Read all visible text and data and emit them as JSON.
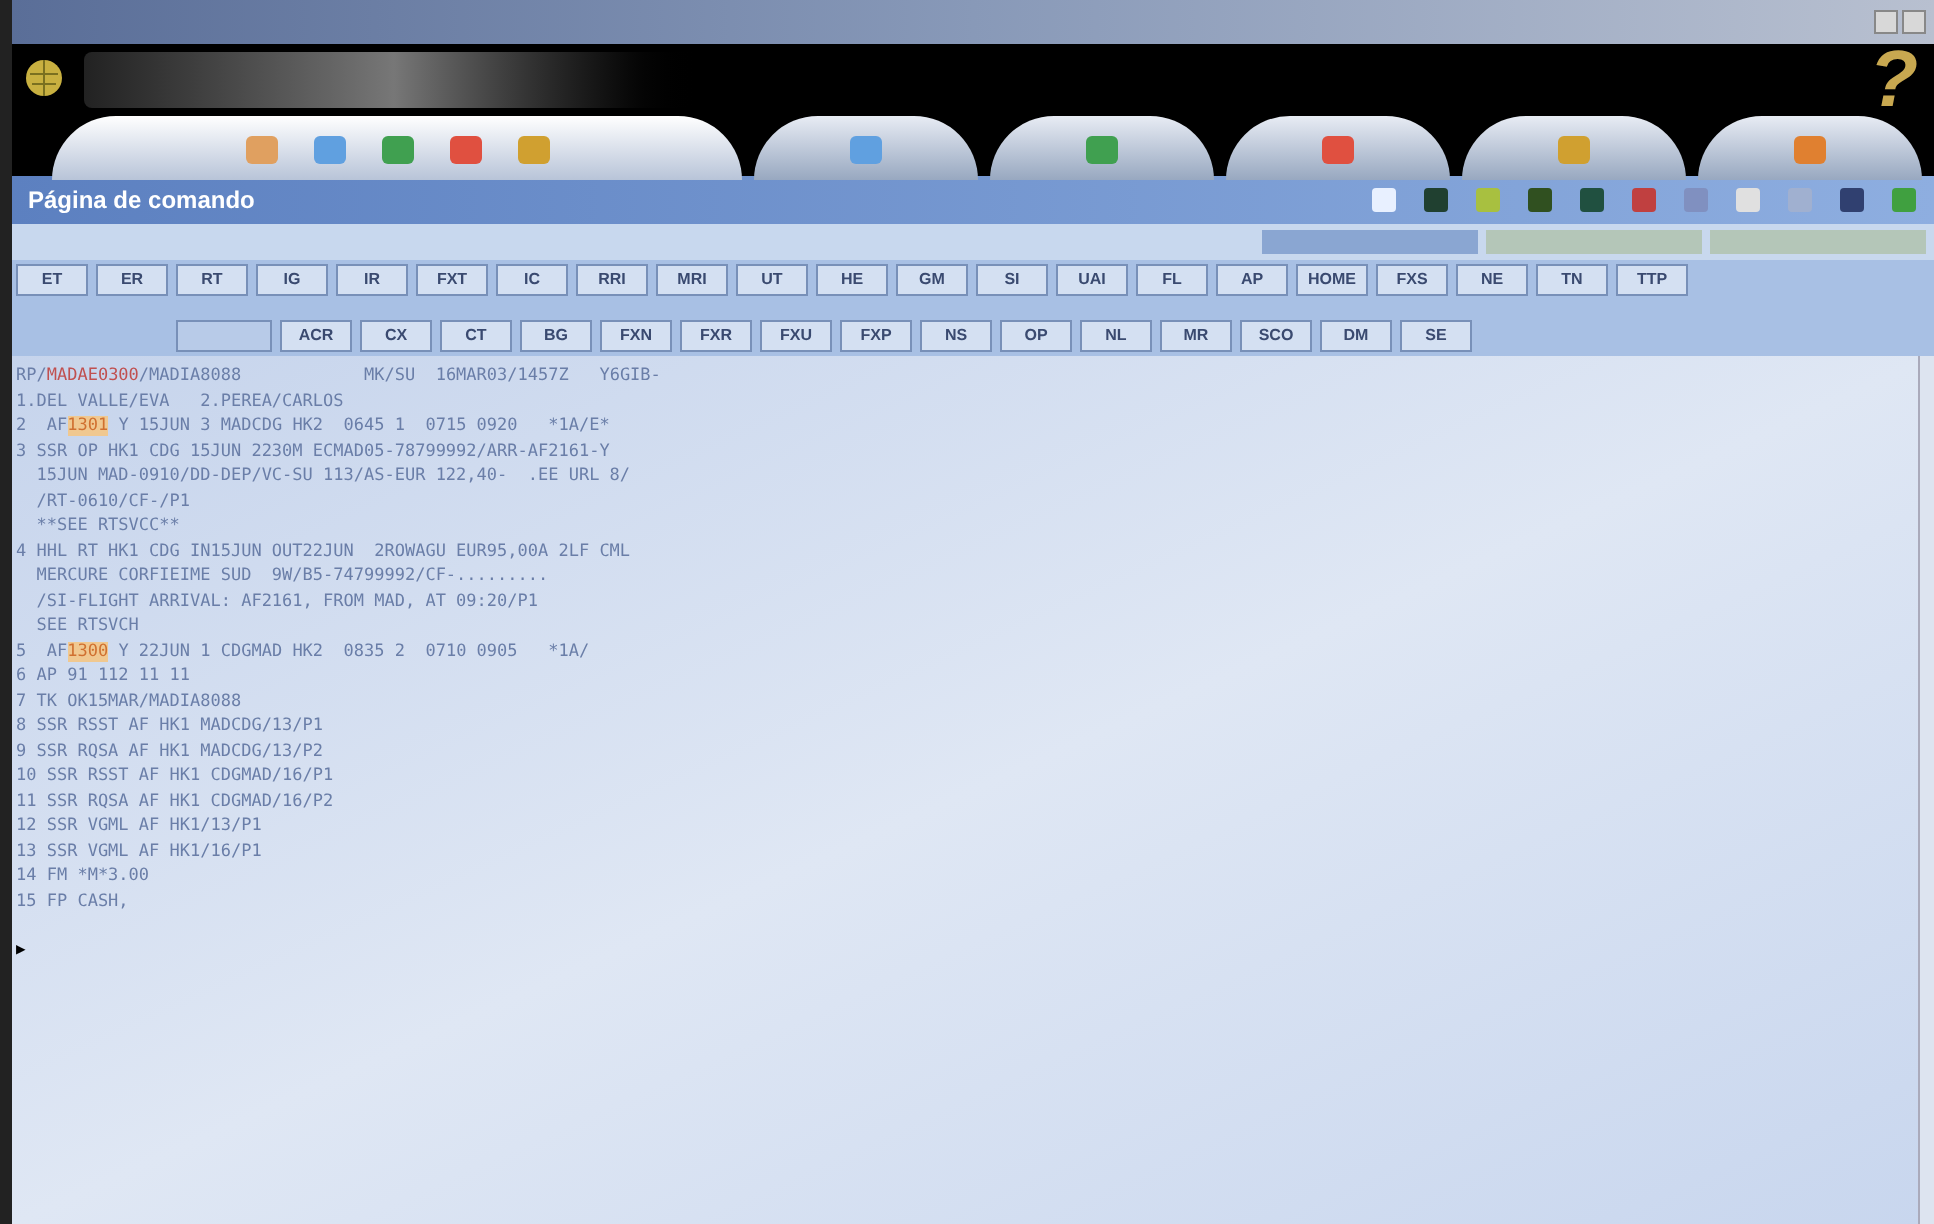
{
  "header": {
    "title": "Página de comando",
    "help": "?"
  },
  "nav_tabs": [
    {
      "kind": "group",
      "selected": true
    },
    {
      "kind": "single",
      "selected": false
    },
    {
      "kind": "single",
      "selected": false
    },
    {
      "kind": "single",
      "selected": false
    },
    {
      "kind": "single",
      "selected": false
    },
    {
      "kind": "single",
      "selected": false
    }
  ],
  "command_rows": [
    {
      "labels": [
        "ET",
        "ER",
        "RT",
        "IG",
        "IR",
        "FXT",
        "IC",
        "RRI",
        "MRI",
        "UT",
        "HE",
        "GM",
        "SI",
        "UAI",
        "FL",
        "AP",
        "HOME",
        "FXS",
        "NE",
        "TN",
        "TTP"
      ]
    },
    {
      "blank_slot": true,
      "labels": [
        "ACR",
        "CX",
        "CT",
        "BG",
        "FXN",
        "FXR",
        "FXU",
        "FXP",
        "NS",
        "OP",
        "NL",
        "MR",
        "SCO",
        "DM",
        "SE"
      ]
    }
  ],
  "panel_tabs": [
    {
      "selected": true
    },
    {
      "selected": false
    },
    {
      "selected": false
    }
  ],
  "terminal": {
    "lines": [
      [
        {
          "kind": "plain",
          "text": "RP/"
        },
        {
          "kind": "record",
          "text": "MADAE0300"
        },
        {
          "kind": "plain",
          "text": "/MADIA8088            MK/SU  16MAR03/1457Z   Y6GIB-"
        }
      ],
      [
        {
          "kind": "plain",
          "text": "1.DEL VALLE/EVA   2.PEREA/CARLOS"
        }
      ],
      [
        {
          "kind": "plain",
          "text": "2  AF"
        },
        {
          "kind": "flight",
          "text": "1301"
        },
        {
          "kind": "plain",
          "text": " Y 15JUN 3 MADCDG HK2  0645 1  0715 0920   *1A/E*"
        }
      ],
      [
        {
          "kind": "plain",
          "text": "3 SSR OP HK1 CDG 15JUN 2230M ECMAD05-78799992/ARR-AF2161-Y"
        }
      ],
      [
        {
          "kind": "plain",
          "text": "  15JUN MAD-0910/DD-DEP/VC-SU 113/AS-EUR 122,40-  .EE URL 8/"
        }
      ],
      [
        {
          "kind": "plain",
          "text": "  /RT-0610/CF-/P1"
        }
      ],
      [
        {
          "kind": "plain",
          "text": "  **SEE RTSVCC**"
        }
      ],
      [
        {
          "kind": "plain",
          "text": "4 HHL RT HK1 CDG IN15JUN OUT22JUN  2ROWAGU EUR95,00A 2LF CML"
        }
      ],
      [
        {
          "kind": "plain",
          "text": "  MERCURE CORFIEIME SUD  9W/B5-74799992/CF-........."
        }
      ],
      [
        {
          "kind": "plain",
          "text": "  /SI-FLIGHT ARRIVAL: AF2161, FROM MAD, AT 09:20/P1"
        }
      ],
      [
        {
          "kind": "plain",
          "text": "  SEE RTSVCH"
        }
      ],
      [
        {
          "kind": "plain",
          "text": "5  AF"
        },
        {
          "kind": "flight",
          "text": "1300"
        },
        {
          "kind": "plain",
          "text": " Y 22JUN 1 CDGMAD HK2  0835 2  0710 0905   *1A/"
        }
      ],
      [
        {
          "kind": "plain",
          "text": "6 AP 91 112 11 11"
        }
      ],
      [
        {
          "kind": "plain",
          "text": "7 TK OK15MAR/MADIA8088"
        }
      ],
      [
        {
          "kind": "plain",
          "text": "8 SSR RSST AF HK1 MADCDG/13/P1"
        }
      ],
      [
        {
          "kind": "plain",
          "text": "9 SSR RQSA AF HK1 MADCDG/13/P2"
        }
      ],
      [
        {
          "kind": "plain",
          "text": "10 SSR RSST AF HK1 CDGMAD/16/P1"
        }
      ],
      [
        {
          "kind": "plain",
          "text": "11 SSR RQSA AF HK1 CDGMAD/16/P2"
        }
      ],
      [
        {
          "kind": "plain",
          "text": "12 SSR VGML AF HK1/13/P1"
        }
      ],
      [
        {
          "kind": "plain",
          "text": "13 SSR VGML AF HK1/16/P1"
        }
      ],
      [
        {
          "kind": "plain",
          "text": "14 FM *M*3.00"
        }
      ],
      [
        {
          "kind": "plain",
          "text": "15 FP CASH,"
        }
      ]
    ],
    "prompt": "▶"
  }
}
